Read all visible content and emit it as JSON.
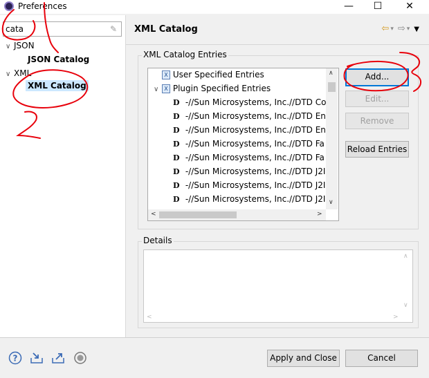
{
  "window": {
    "title": "Preferences",
    "minimize": "—",
    "maximize": "☐",
    "close": "✕"
  },
  "filter": {
    "value": "cata",
    "clear_icon": "eraser-icon"
  },
  "tree": [
    {
      "label": "JSON",
      "expanded": true,
      "children": [
        {
          "label": "JSON Catalog",
          "selected": false
        }
      ]
    },
    {
      "label": "XML",
      "expanded": true,
      "children": [
        {
          "label": "XML Catalog",
          "selected": true
        }
      ]
    }
  ],
  "page": {
    "title": "XML Catalog"
  },
  "nav": {
    "back": "⇦",
    "forward": "⇨",
    "dropdown": "▾",
    "menu": "▼"
  },
  "entries_group": {
    "label": "XML Catalog Entries",
    "items": [
      {
        "label": "User Specified Entries",
        "type": "folder",
        "level": 0,
        "twisty": ""
      },
      {
        "label": "Plugin Specified Entries",
        "type": "folder",
        "level": 0,
        "twisty": "∨"
      },
      {
        "label": "-//Sun Microsystems, Inc.//DTD Co",
        "type": "dtd",
        "level": 1
      },
      {
        "label": "-//Sun Microsystems, Inc.//DTD En",
        "type": "dtd",
        "level": 1
      },
      {
        "label": "-//Sun Microsystems, Inc.//DTD En",
        "type": "dtd",
        "level": 1
      },
      {
        "label": "-//Sun Microsystems, Inc.//DTD Fa",
        "type": "dtd",
        "level": 1
      },
      {
        "label": "-//Sun Microsystems, Inc.//DTD Fa",
        "type": "dtd",
        "level": 1
      },
      {
        "label": "-//Sun Microsystems, Inc.//DTD J2I",
        "type": "dtd",
        "level": 1
      },
      {
        "label": "-//Sun Microsystems, Inc.//DTD J2I",
        "type": "dtd",
        "level": 1
      },
      {
        "label": "-//Sun Microsystems, Inc.//DTD J2I",
        "type": "dtd",
        "level": 1
      }
    ]
  },
  "buttons": {
    "add": "Add...",
    "edit": "Edit...",
    "remove": "Remove",
    "reload": "Reload Entries",
    "apply_close": "Apply and Close",
    "cancel": "Cancel"
  },
  "details_group": {
    "label": "Details"
  },
  "bottom_icons": [
    "help-icon",
    "import-icon",
    "export-icon",
    "record-icon"
  ],
  "annotation": {
    "number_label": "2",
    "color": "#e8000b"
  }
}
